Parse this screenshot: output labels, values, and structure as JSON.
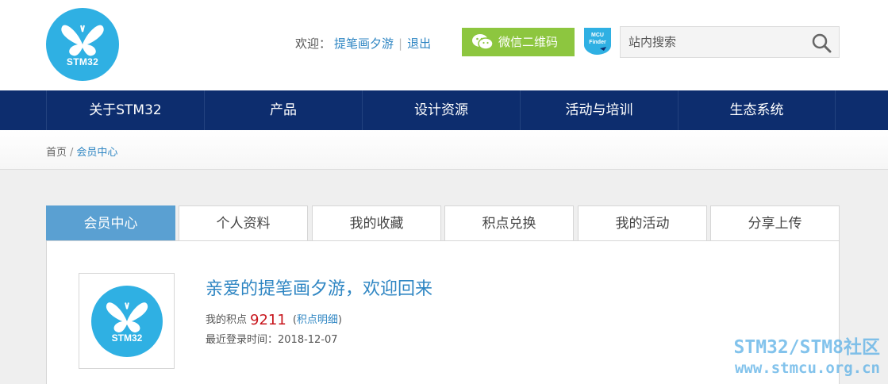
{
  "header": {
    "logo_text": "STM32",
    "welcome_label": "欢迎：",
    "username": "提笔画夕游",
    "separator": "|",
    "logout_label": "退出",
    "wechat_label": "微信二维码",
    "mcu_finder_text_1": "MCU",
    "mcu_finder_text_2": "Finder",
    "search_placeholder": "站内搜索"
  },
  "nav": {
    "items": [
      {
        "label": "关于STM32"
      },
      {
        "label": "产品"
      },
      {
        "label": "设计资源"
      },
      {
        "label": "活动与培训"
      },
      {
        "label": "生态系统"
      }
    ]
  },
  "breadcrumb": {
    "home": "首页",
    "slash": "/",
    "current": "会员中心"
  },
  "tabs": [
    {
      "label": "会员中心",
      "active": true
    },
    {
      "label": "个人资料"
    },
    {
      "label": "我的收藏"
    },
    {
      "label": "积点兑换"
    },
    {
      "label": "我的活动"
    },
    {
      "label": "分享上传"
    }
  ],
  "profile": {
    "avatar_text": "STM32",
    "greeting": "亲爱的提笔画夕游，欢迎回来",
    "points_label": "我的积点",
    "points_value": "9211",
    "paren_open": "(",
    "points_detail_link": "积点明细",
    "paren_close": ")",
    "last_login": "最近登录时间：2018-12-07"
  },
  "watermark": {
    "line1": "STM32/STM8社区",
    "line2": "www.stmcu.org.cn"
  },
  "colors": {
    "brand_blue": "#2fb0e3",
    "nav_bg": "#0d2d6e",
    "link": "#2f86c3",
    "wechat_green": "#8dc63f",
    "points_red": "#c8161d",
    "tab_active": "#5aa0d2"
  }
}
